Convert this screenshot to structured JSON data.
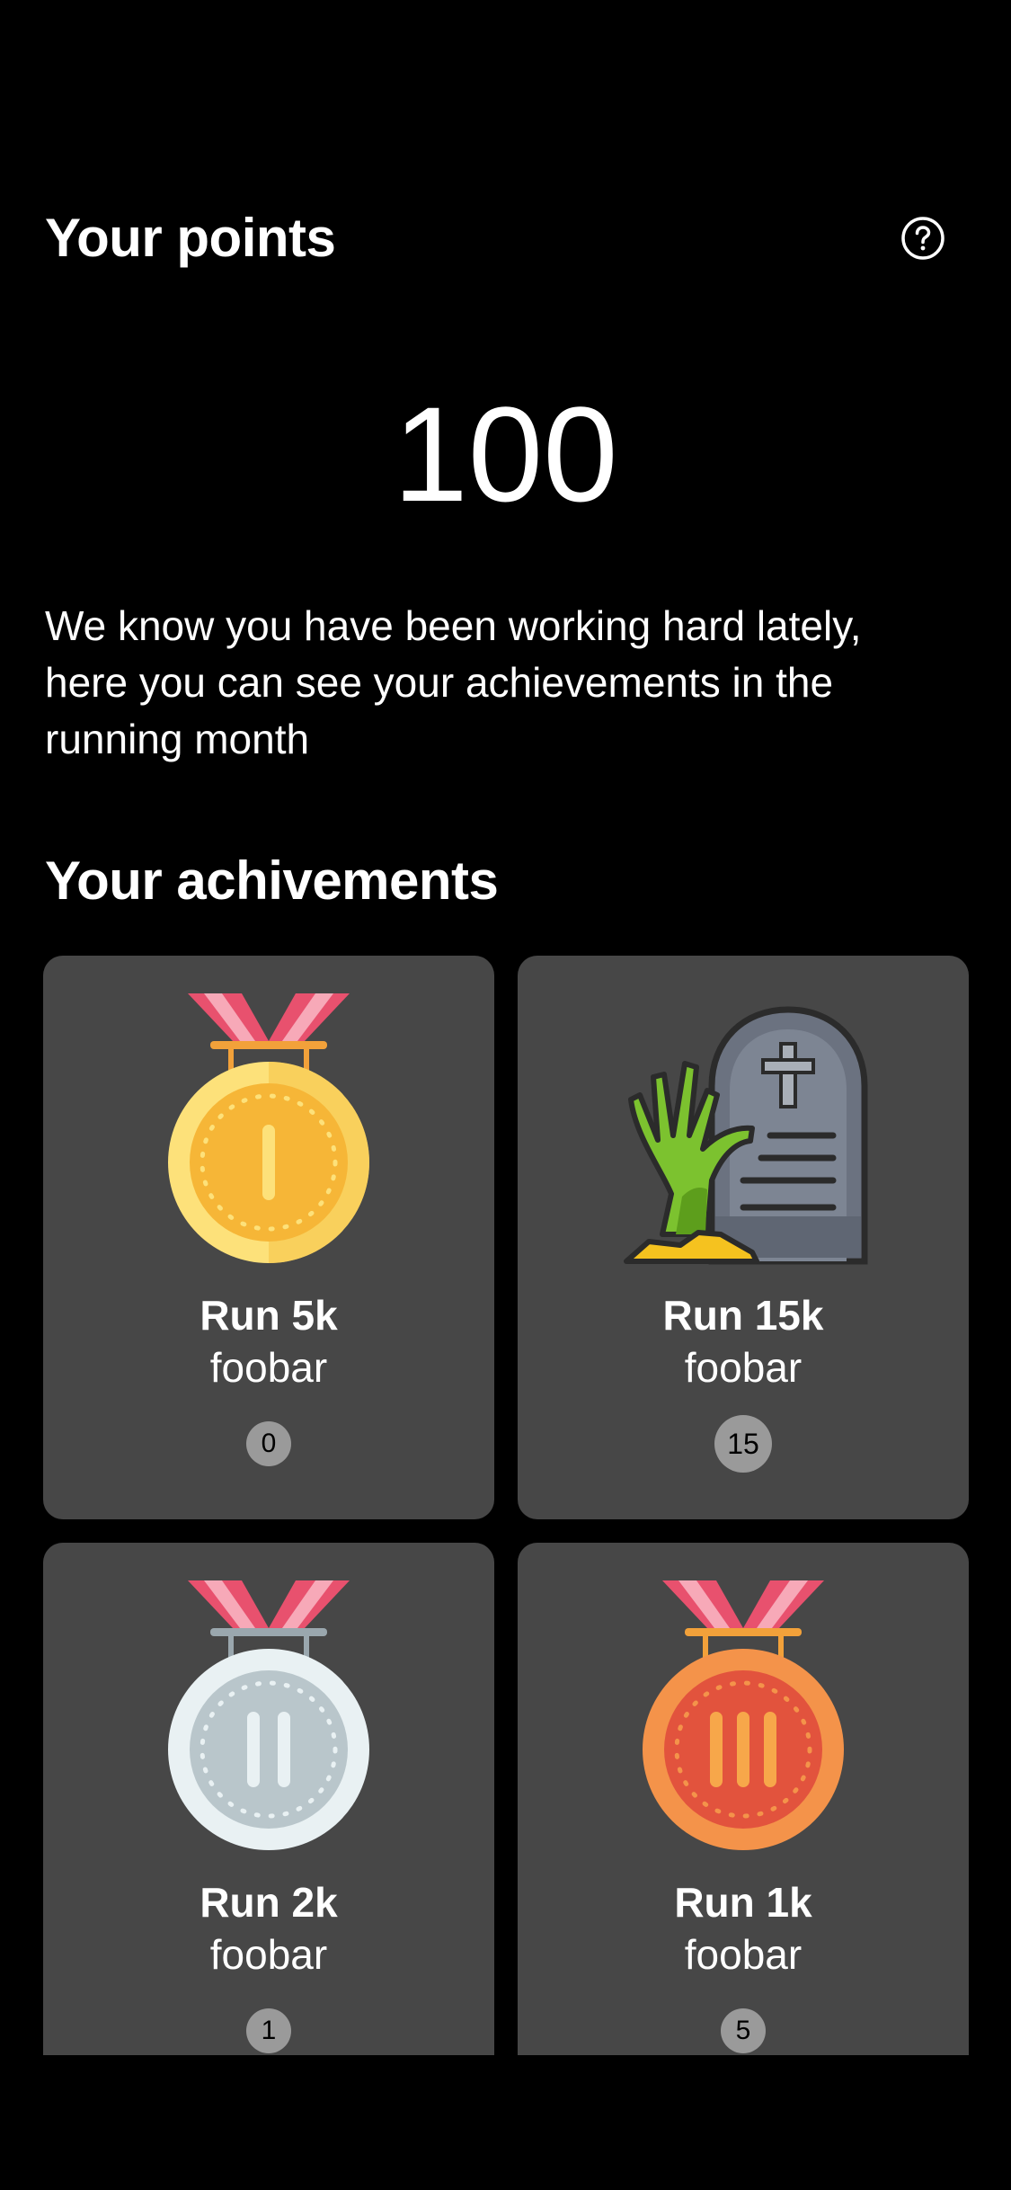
{
  "header": {
    "title": "Your points",
    "help_icon": "help-circle-icon"
  },
  "points": {
    "value": "100"
  },
  "description": "We know you have been working hard lately, here you can see your achievements in the running month",
  "achievements": {
    "title": "Your achivements",
    "items": [
      {
        "title": "Run 5k",
        "subtitle": "foobar",
        "count": "0",
        "icon": "gold-medal-icon"
      },
      {
        "title": "Run 15k",
        "subtitle": "foobar",
        "count": "15",
        "icon": "zombie-grave-icon"
      },
      {
        "title": "Run 2k",
        "subtitle": "foobar",
        "count": "1",
        "icon": "silver-medal-icon"
      },
      {
        "title": "Run 1k",
        "subtitle": "foobar",
        "count": "5",
        "icon": "bronze-medal-icon"
      }
    ]
  },
  "colors": {
    "background": "#000000",
    "card": "#474747",
    "badge": "#9a9a9a",
    "text": "#ffffff"
  }
}
